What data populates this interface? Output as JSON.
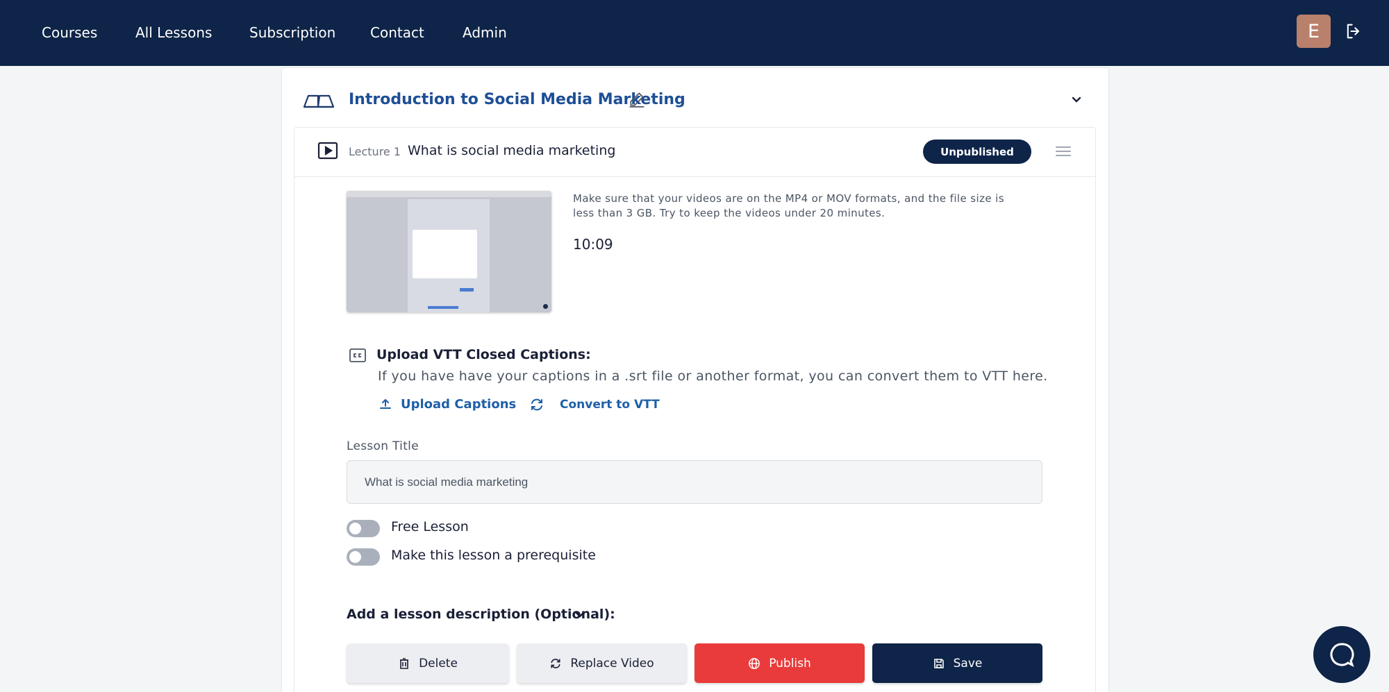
{
  "nav": {
    "items": [
      "Courses",
      "All Lessons",
      "Subscription",
      "Contact",
      "Admin"
    ],
    "avatar_initial": "E",
    "logout_icon": "logout-icon"
  },
  "section": {
    "title": "Introduction to Social Media Marketing",
    "icon": "book-open-icon"
  },
  "lecture": {
    "number_label": "Lecture 1",
    "title": "What is social media marketing",
    "status": "Unpublished",
    "video_note": "Make sure that your videos are on the MP4 or MOV formats, and the file size is less than 3 GB. Try to keep the videos under 20 minutes.",
    "duration": "10:09"
  },
  "captions": {
    "title": "Upload VTT Closed Captions:",
    "description": "If you have have your captions in a .srt file or another format, you can convert them to VTT here.",
    "upload_label": "Upload Captions",
    "convert_label": "Convert to VTT"
  },
  "form": {
    "lesson_title_label": "Lesson Title",
    "lesson_title_value": "What is social media marketing",
    "free_lesson_label": "Free Lesson",
    "free_lesson_on": false,
    "prerequisite_label": "Make this lesson a prerequisite",
    "prerequisite_on": false,
    "description_toggle": "Add a lesson description (Optional):"
  },
  "actions": {
    "delete": "Delete",
    "replace": "Replace Video",
    "publish": "Publish",
    "save": "Save"
  },
  "colors": {
    "navy": "#0e2448",
    "link": "#1e5fa8",
    "danger": "#e93b3b"
  }
}
